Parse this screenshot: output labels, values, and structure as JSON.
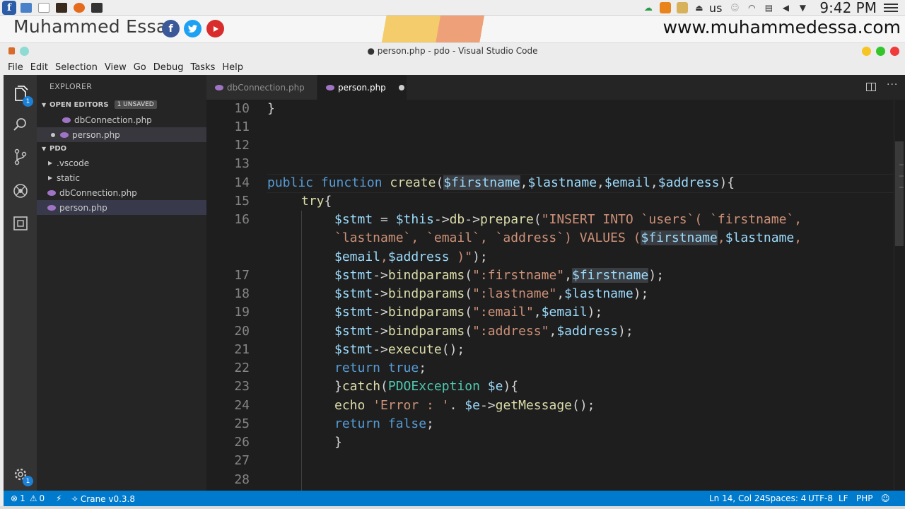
{
  "os_panel": {
    "logo": "f",
    "lang": "us",
    "time": "9:42 PM"
  },
  "banner": {
    "name": "Muhammed Essa",
    "facebook": "f",
    "url": "www.muhammedessa.com"
  },
  "window": {
    "title": "● person.php - pdo - Visual Studio Code"
  },
  "menu": [
    "File",
    "Edit",
    "Selection",
    "View",
    "Go",
    "Debug",
    "Tasks",
    "Help"
  ],
  "activity": {
    "explorer_badge": "1",
    "settings_badge": "1"
  },
  "sidebar": {
    "title": "EXPLORER",
    "open_editors": {
      "label": "OPEN EDITORS",
      "badge": "1 UNSAVED",
      "files": [
        "dbConnection.php",
        "person.php"
      ]
    },
    "folder": {
      "label": "PDO",
      "items": [
        ".vscode",
        "static",
        "dbConnection.php",
        "person.php"
      ]
    }
  },
  "tabs": [
    {
      "label": "dbConnection.php"
    },
    {
      "label": "person.php"
    }
  ],
  "editor": {
    "line_numbers": [
      "10",
      "11",
      "12",
      "13",
      "14",
      "15",
      "16",
      "",
      "",
      "17",
      "18",
      "19",
      "20",
      "21",
      "22",
      "23",
      "24",
      "25",
      "26",
      "27",
      "28"
    ]
  },
  "status": {
    "errors": "1",
    "warnings": "0",
    "extension": "Crane v0.3.8",
    "position": "Ln 14, Col 24",
    "spaces": "Spaces: 4",
    "encoding": "UTF-8",
    "eol": "LF",
    "language": "PHP"
  },
  "colors": {
    "status_bar": "#007acc",
    "editor_bg": "#1e1e1e",
    "keyword": "#569cd6",
    "variable": "#9cdcfe",
    "string": "#ce9178"
  }
}
